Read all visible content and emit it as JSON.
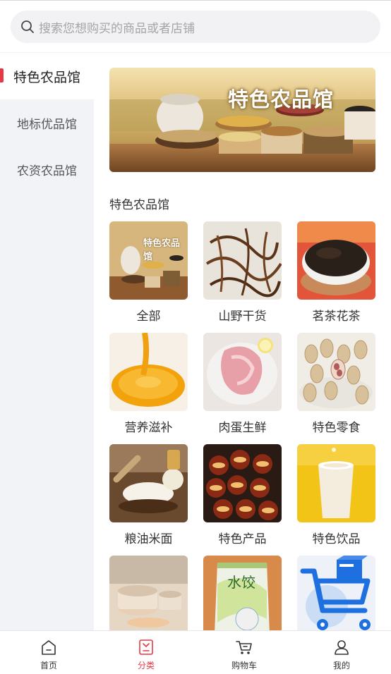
{
  "search": {
    "placeholder": "搜索您想购买的商品或者店铺"
  },
  "sidebar": {
    "items": [
      {
        "label": "特色农品馆",
        "active": true
      },
      {
        "label": "地标优品馆",
        "active": false
      },
      {
        "label": "农资农品馆",
        "active": false
      }
    ]
  },
  "banner": {
    "text": "特色农品馆"
  },
  "section": {
    "title": "特色农品馆"
  },
  "categories": [
    {
      "label": "全部",
      "thumb_text": "特色农品馆"
    },
    {
      "label": "山野干货"
    },
    {
      "label": "茗茶花茶"
    },
    {
      "label": "营养滋补"
    },
    {
      "label": "肉蛋生鲜"
    },
    {
      "label": "特色零食"
    },
    {
      "label": "粮油米面"
    },
    {
      "label": "特色产品"
    },
    {
      "label": "特色饮品"
    },
    {
      "label": ""
    },
    {
      "label": "",
      "package_text": "水饺"
    },
    {
      "label": ""
    }
  ],
  "tabbar": {
    "items": [
      {
        "label": "首页",
        "icon": "home-icon"
      },
      {
        "label": "分类",
        "icon": "category-icon",
        "active": true
      },
      {
        "label": "购物车",
        "icon": "cart-icon"
      },
      {
        "label": "我的",
        "icon": "user-icon"
      }
    ]
  },
  "colors": {
    "accent": "#e63946",
    "sidebar_bg": "#f2f3f7",
    "search_bg": "#f2f2f5",
    "cart_blue": "#1e6fe0"
  }
}
